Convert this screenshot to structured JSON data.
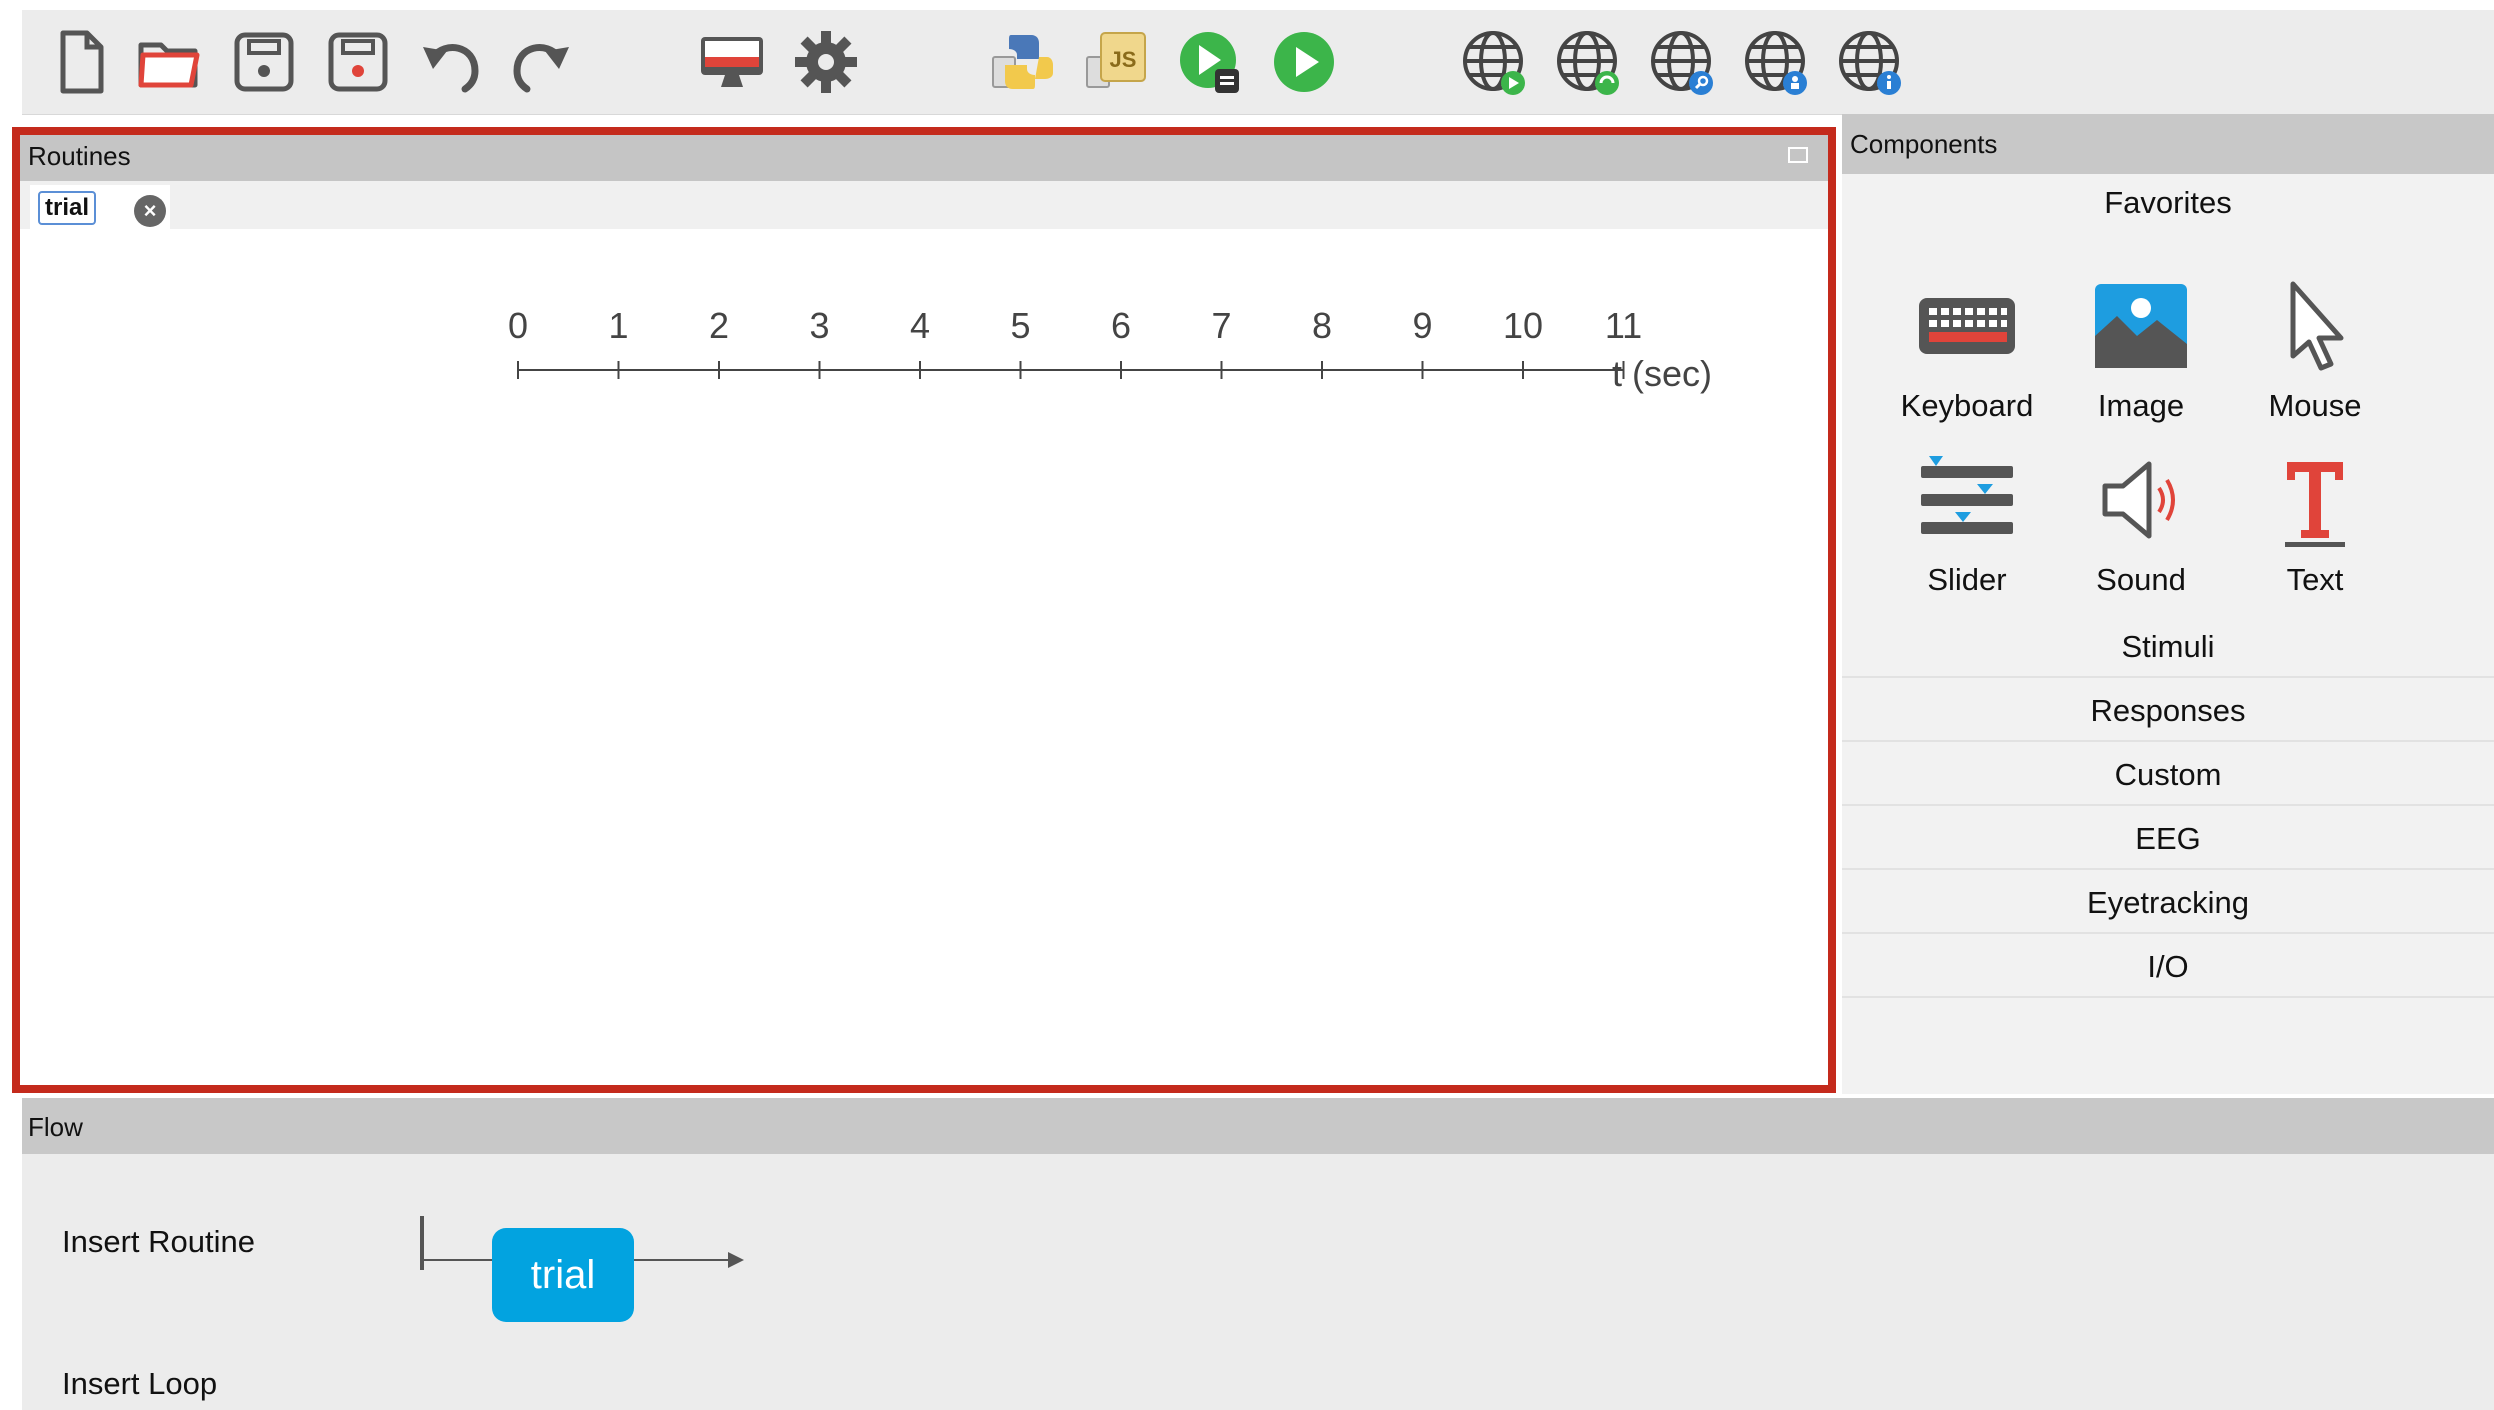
{
  "toolbar": {
    "buttons": [
      {
        "name": "new-file",
        "icon": "new-file-icon"
      },
      {
        "name": "open-file",
        "icon": "open-folder-icon"
      },
      {
        "name": "save",
        "icon": "save-icon"
      },
      {
        "name": "save-as",
        "icon": "save-as-icon"
      },
      {
        "name": "undo",
        "icon": "undo-icon"
      },
      {
        "name": "redo",
        "icon": "redo-icon"
      },
      {
        "name": "monitor-center",
        "icon": "monitor-icon"
      },
      {
        "name": "experiment-settings",
        "icon": "gear-icon"
      },
      {
        "name": "compile-python",
        "icon": "python-icon"
      },
      {
        "name": "compile-js",
        "icon": "js-file-icon"
      },
      {
        "name": "run-runner",
        "icon": "run-runner-icon"
      },
      {
        "name": "run",
        "icon": "play-icon"
      },
      {
        "name": "online-run",
        "icon": "globe-run-icon"
      },
      {
        "name": "online-sync",
        "icon": "globe-sync-icon"
      },
      {
        "name": "online-search",
        "icon": "globe-search-icon"
      },
      {
        "name": "online-user",
        "icon": "globe-user-icon"
      },
      {
        "name": "online-info",
        "icon": "globe-info-icon"
      }
    ]
  },
  "routines": {
    "title": "Routines",
    "tabs": [
      {
        "label": "trial",
        "close_icon": "close-icon"
      }
    ],
    "timeline": {
      "ticks": [
        "0",
        "1",
        "2",
        "3",
        "4",
        "5",
        "6",
        "7",
        "8",
        "9",
        "10",
        "11"
      ],
      "unit": "t (sec)"
    }
  },
  "components": {
    "title": "Components",
    "favorites_label": "Favorites",
    "favorites": [
      {
        "label": "Keyboard",
        "icon": "keyboard-icon"
      },
      {
        "label": "Image",
        "icon": "image-icon"
      },
      {
        "label": "Mouse",
        "icon": "mouse-pointer-icon"
      },
      {
        "label": "Slider",
        "icon": "slider-icon"
      },
      {
        "label": "Sound",
        "icon": "speaker-icon"
      },
      {
        "label": "Text",
        "icon": "text-t-icon"
      }
    ],
    "categories": [
      "Stimuli",
      "Responses",
      "Custom",
      "EEG",
      "Eyetracking",
      "I/O"
    ]
  },
  "flow": {
    "title": "Flow",
    "insert_routine": "Insert Routine",
    "insert_loop": "Insert Loop",
    "routines": [
      "trial"
    ]
  },
  "colors": {
    "highlight_border": "#c42a1c",
    "run_green": "#3cb54a",
    "flow_routine_blue": "#02a3e0",
    "icon_gray": "#555555",
    "accent_red": "#e0443a"
  }
}
